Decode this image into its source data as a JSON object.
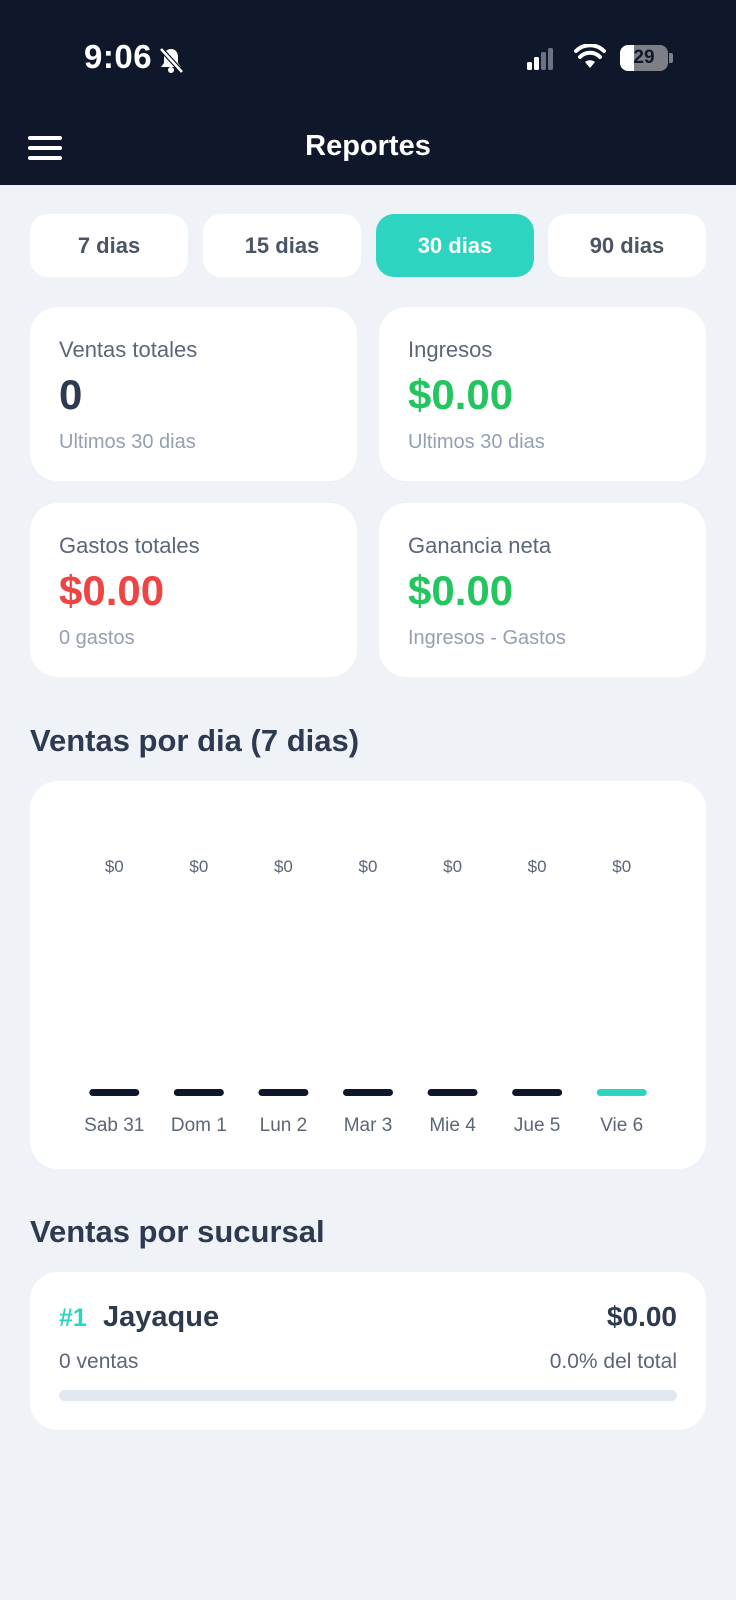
{
  "status_bar": {
    "time": "9:06",
    "battery": "29",
    "battery_level": 0.29
  },
  "header": {
    "title": "Reportes",
    "menu_icon": "hamburger-menu-icon"
  },
  "period_tabs": [
    {
      "label": "7 dias",
      "active": false
    },
    {
      "label": "15 dias",
      "active": false
    },
    {
      "label": "30 dias",
      "active": true
    },
    {
      "label": "90 dias",
      "active": false
    }
  ],
  "stats": {
    "ventas": {
      "label": "Ventas totales",
      "value": "0",
      "sub": "Ultimos 30 dias",
      "color": "#2d3a4f"
    },
    "ingresos": {
      "label": "Ingresos",
      "value": "$0.00",
      "sub": "Ultimos 30 dias",
      "color": "#22c55e"
    },
    "gastos": {
      "label": "Gastos totales",
      "value": "$0.00",
      "sub": "0 gastos",
      "color": "#ef4444"
    },
    "ganancia": {
      "label": "Ganancia neta",
      "value": "$0.00",
      "sub": "Ingresos - Gastos",
      "color": "#22c55e"
    }
  },
  "sales_by_day": {
    "title": "Ventas por dia (7 dias)"
  },
  "chart_data": {
    "type": "bar",
    "categories": [
      "Sab 31",
      "Dom 1",
      "Lun 2",
      "Mar 3",
      "Mie 4",
      "Jue 5",
      "Vie 6"
    ],
    "values": [
      0,
      0,
      0,
      0,
      0,
      0,
      0
    ],
    "value_labels": [
      "$0",
      "$0",
      "$0",
      "$0",
      "$0",
      "$0",
      "$0"
    ],
    "highlight_index": 6,
    "bar_color": "#0f172a",
    "highlight_color": "#2dd4bf"
  },
  "sales_by_branch": {
    "title": "Ventas por sucursal",
    "items": [
      {
        "rank": "#1",
        "name": "Jayaque",
        "amount": "$0.00",
        "sales": "0 ventas",
        "pct": "0.0% del total",
        "fraction": 0.0
      }
    ]
  },
  "colors": {
    "accent": "#2dd4bf",
    "header_bg": "#0f172a",
    "page_bg": "#eff3f8"
  }
}
